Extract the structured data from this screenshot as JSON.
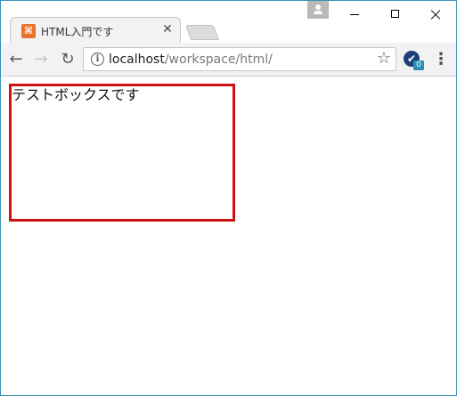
{
  "tab": {
    "title": "HTML入門です",
    "favicon_glyph": "⌘",
    "close_glyph": "✕"
  },
  "toolbar": {
    "back_glyph": "←",
    "forward_glyph": "→",
    "reload_glyph": "↻",
    "info_glyph": "i",
    "url_host": "localhost",
    "url_path": "/workspace/html/",
    "star_glyph": "☆",
    "extension_badge": "0",
    "extension_glyph": "✔",
    "menu_glyph": "⋮"
  },
  "page": {
    "box_text": "テストボックスです"
  },
  "colors": {
    "box_border": "#cc1111",
    "favicon": "#e8712c",
    "window_border": "#3c8fb6"
  }
}
